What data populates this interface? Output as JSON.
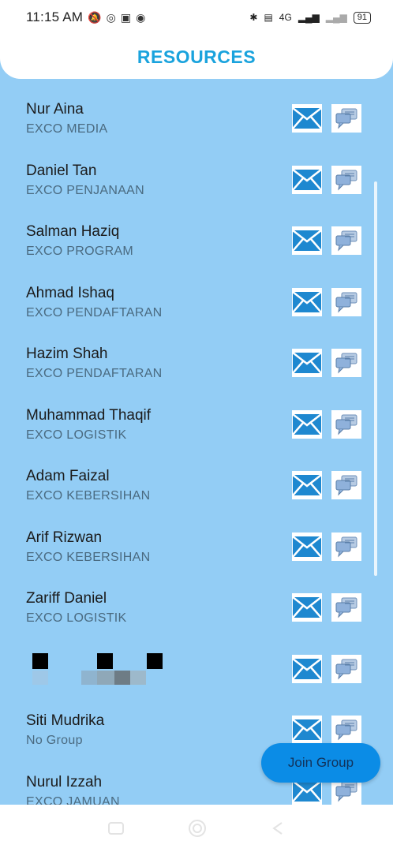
{
  "status_bar": {
    "time": "11:15 AM",
    "network": "4G",
    "battery": "91"
  },
  "header": {
    "title": "RESOURCES"
  },
  "contacts": [
    {
      "name": "Nur Aina",
      "group": "EXCO MEDIA"
    },
    {
      "name": "Daniel Tan",
      "group": "EXCO PENJANAAN"
    },
    {
      "name": "Salman Haziq",
      "group": "EXCO PROGRAM"
    },
    {
      "name": "Ahmad Ishaq",
      "group": "EXCO PENDAFTARAN"
    },
    {
      "name": "Hazim Shah",
      "group": "EXCO PENDAFTARAN"
    },
    {
      "name": "Muhammad Thaqif",
      "group": "EXCO LOGISTIK"
    },
    {
      "name": "Adam Faizal",
      "group": "EXCO KEBERSIHAN"
    },
    {
      "name": "Arif Rizwan",
      "group": "EXCO KEBERSIHAN"
    },
    {
      "name": "Zariff Daniel",
      "group": "EXCO LOGISTIK"
    },
    {
      "name": "",
      "group": ""
    },
    {
      "name": "Siti Mudrika",
      "group": "No Group"
    },
    {
      "name": "Nurul Izzah",
      "group": "EXCO JAMUAN"
    }
  ],
  "fab": {
    "label": "Join Group"
  },
  "icons": {
    "mail": "envelope-icon",
    "chat": "chat-bubble-icon"
  },
  "colors": {
    "background": "#93CDF5",
    "title": "#1AA3DD",
    "fab": "#0B8CE6"
  }
}
